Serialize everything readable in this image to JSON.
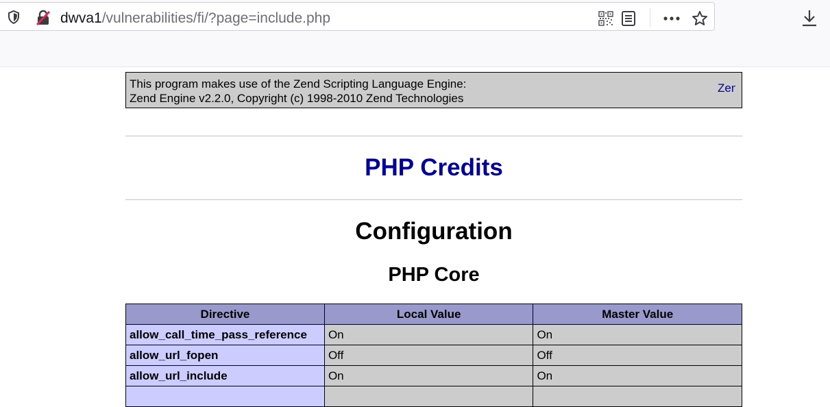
{
  "browser": {
    "url_host": "dwva1",
    "url_path": "/vulnerabilities/fi/?page=include.php",
    "icons": [
      "shield-icon",
      "insecure-lock-icon",
      "qr-code-icon",
      "reader-mode-icon",
      "more-actions-icon",
      "bookmark-star-icon",
      "download-icon"
    ]
  },
  "zend": {
    "line1": "This program makes use of the Zend Scripting Language Engine:",
    "line2": "Zend Engine v2.2.0, Copyright (c) 1998-2010 Zend Technologies",
    "logo_link": "Zend"
  },
  "headings": {
    "credits": "PHP Credits",
    "configuration": "Configuration",
    "section": "PHP Core"
  },
  "table": {
    "headers": [
      "Directive",
      "Local Value",
      "Master Value"
    ],
    "rows": [
      [
        "allow_call_time_pass_reference",
        "On",
        "On"
      ],
      [
        "allow_url_fopen",
        "Off",
        "Off"
      ],
      [
        "allow_url_include",
        "On",
        "On"
      ]
    ]
  },
  "colors": {
    "heading_blue": "#000099",
    "header_row": "#9999cc",
    "directive_cell": "#ccccff",
    "value_cell": "#cccccc"
  }
}
